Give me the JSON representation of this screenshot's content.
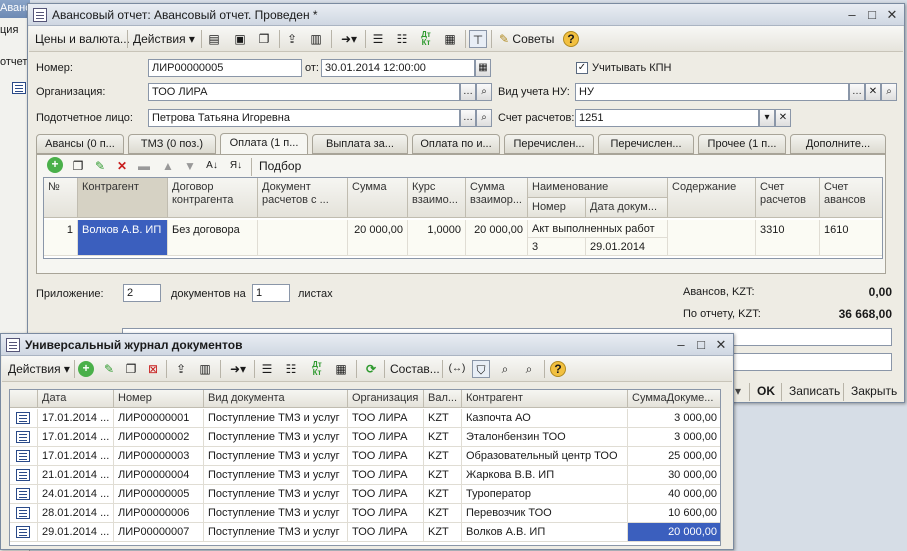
{
  "bg_window": {
    "title_fragment": "Авансо",
    "tab_fragment": "ция",
    "item_fragment": "отчет"
  },
  "doc": {
    "title": "Авансовый отчет: Авансовый отчет. Проведен *",
    "toolbar": {
      "prices": "Цены и валюта...",
      "actions": "Действия",
      "tips": "Советы",
      "dtkt": "Дт Кт"
    },
    "fields": {
      "number_label": "Номер:",
      "number_value": "ЛИР00000005",
      "date_label": "от:",
      "date_value": "30.01.2014 12:00:00",
      "kpn_label": "Учитывать КПН",
      "org_label": "Организация:",
      "org_value": "ТОО ЛИРА",
      "nu_label": "Вид учета НУ:",
      "nu_value": "НУ",
      "person_label": "Подотчетное лицо:",
      "person_value": "Петрова Татьяна Игоревна",
      "account_label": "Счет расчетов:",
      "account_value": "1251"
    },
    "tabs": [
      "Авансы (0 п...",
      "ТМЗ (0 поз.)",
      "Оплата (1 п...",
      "Выплата за...",
      "Оплата по и...",
      "Перечислен...",
      "Перечислен...",
      "Прочее (1 п...",
      "Дополните..."
    ],
    "panel_toolbar": {
      "pick": "Подбор"
    },
    "grid_headers": {
      "n": "№",
      "contractor": "Контрагент",
      "contract": "Договор контрагента",
      "settle_doc": "Документ расчетов с ...",
      "sum": "Сумма",
      "rate": "Курс взаимо...",
      "sum_mutual": "Сумма взаимор...",
      "doc_name": "Наименование докумен...",
      "doc_num": "Номер д...",
      "doc_date": "Дата докум...",
      "content": "Содержание",
      "acc_settle": "Счет расчетов",
      "acc_adv": "Счет авансов"
    },
    "grid_row": {
      "n": "1",
      "contractor": "Волков А.В. ИП",
      "contract": "Без договора",
      "settle_doc": "",
      "sum": "20 000,00",
      "rate": "1,0000",
      "sum_mutual": "20 000,00",
      "doc_name": "Акт выполненных работ",
      "doc_num": "3",
      "doc_date": "29.01.2014",
      "content": "",
      "acc_settle": "3310",
      "acc_adv": "1610"
    },
    "footer": {
      "attach_label": "Приложение:",
      "attach_value": "2",
      "docs_on_label": "документов на",
      "sheets_value": "1",
      "sheets_label": "листах",
      "advances_label": "Авансов, KZT:",
      "advances_value": "0,00",
      "report_label": "По отчету, KZT:",
      "report_value": "36 668,00"
    },
    "buttons": {
      "ok": "OK",
      "save": "Записать",
      "close": "Закрыть"
    }
  },
  "journal": {
    "title": "Универсальный журнал документов",
    "toolbar": {
      "actions": "Действия",
      "compose": "Состав...",
      "dtkt": "Дт Кт"
    },
    "headers": [
      "Дата",
      "Номер",
      "Вид документа",
      "Организация",
      "Вал...",
      "Контрагент",
      "СуммаДокуме..."
    ],
    "rows": [
      {
        "date": "17.01.2014 ...",
        "num": "ЛИР00000001",
        "type": "Поступление ТМЗ и услуг",
        "org": "ТОО ЛИРА",
        "cur": "KZT",
        "contractor": "Казпочта АО",
        "sum": "3 000,00"
      },
      {
        "date": "17.01.2014 ...",
        "num": "ЛИР00000002",
        "type": "Поступление ТМЗ и услуг",
        "org": "ТОО ЛИРА",
        "cur": "KZT",
        "contractor": "Эталонбензин ТОО",
        "sum": "3 000,00"
      },
      {
        "date": "17.01.2014 ...",
        "num": "ЛИР00000003",
        "type": "Поступление ТМЗ и услуг",
        "org": "ТОО ЛИРА",
        "cur": "KZT",
        "contractor": "Образовательный центр ТОО",
        "sum": "25 000,00"
      },
      {
        "date": "21.01.2014 ...",
        "num": "ЛИР00000004",
        "type": "Поступление ТМЗ и услуг",
        "org": "ТОО ЛИРА",
        "cur": "KZT",
        "contractor": "Жаркова В.В. ИП",
        "sum": "30 000,00"
      },
      {
        "date": "24.01.2014 ...",
        "num": "ЛИР00000005",
        "type": "Поступление ТМЗ и услуг",
        "org": "ТОО ЛИРА",
        "cur": "KZT",
        "contractor": "Туроператор",
        "sum": "40 000,00"
      },
      {
        "date": "28.01.2014 ...",
        "num": "ЛИР00000006",
        "type": "Поступление ТМЗ и услуг",
        "org": "ТОО ЛИРА",
        "cur": "KZT",
        "contractor": "Перевозчик ТОО",
        "sum": "10 600,00"
      },
      {
        "date": "29.01.2014 ...",
        "num": "ЛИР00000007",
        "type": "Поступление ТМЗ и услуг",
        "org": "ТОО ЛИРА",
        "cur": "KZT",
        "contractor": "Волков А.В. ИП",
        "sum": "20 000,00"
      }
    ]
  },
  "colors": {
    "selection": "#3b5fbe",
    "accent_green": "#2f9a2f",
    "accent_red": "#c81e1e"
  }
}
